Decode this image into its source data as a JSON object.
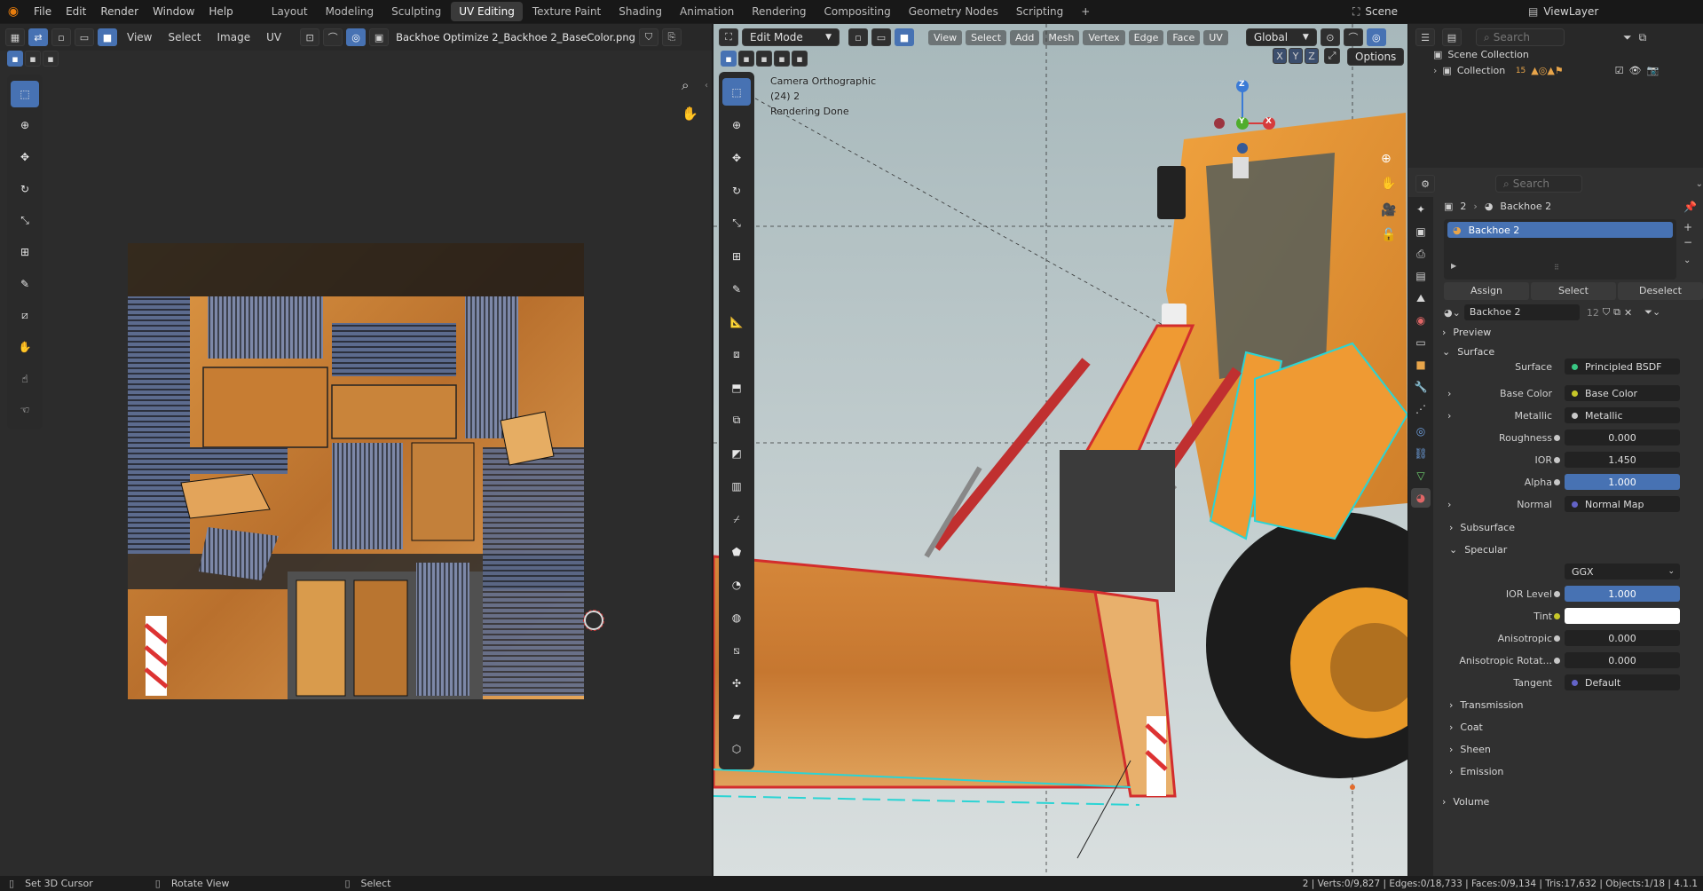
{
  "menu": {
    "items": [
      "File",
      "Edit",
      "Render",
      "Window",
      "Help"
    ]
  },
  "workspaces": {
    "tabs": [
      "Layout",
      "Modeling",
      "Sculpting",
      "UV Editing",
      "Texture Paint",
      "Shading",
      "Animation",
      "Rendering",
      "Compositing",
      "Geometry Nodes",
      "Scripting"
    ],
    "active": "UV Editing",
    "add_label": "+"
  },
  "scene": {
    "name": "Scene",
    "view_layer": "ViewLayer"
  },
  "uv_editor": {
    "menus": [
      "View",
      "Select",
      "Image",
      "UV"
    ],
    "image_name": "Backhoe Optimize 2_Backhoe 2_BaseColor.png"
  },
  "viewport": {
    "mode": "Edit Mode",
    "menus": [
      "View",
      "Select",
      "Add",
      "Mesh",
      "Vertex",
      "Edge",
      "Face",
      "UV"
    ],
    "transform_orientation": "Global",
    "axes": [
      "X",
      "Y",
      "Z"
    ],
    "options_label": "Options",
    "overlay_text": [
      "Camera Orthographic",
      "(24) 2",
      "Rendering Done"
    ],
    "gizmo_axes": {
      "z": "Z",
      "y": "Y",
      "x": "X"
    }
  },
  "outliner": {
    "search_placeholder": "Search",
    "scene_collection": "Scene Collection",
    "collection": "Collection",
    "collection_count": "15"
  },
  "properties": {
    "search_placeholder": "Search",
    "breadcrumb": {
      "object": "2",
      "material": "Backhoe 2"
    },
    "slot_name": "Backhoe 2",
    "assign_label": "Assign",
    "select_label": "Select",
    "deselect_label": "Deselect",
    "material_name": "Backhoe 2",
    "material_users": "12",
    "sections": {
      "preview": "Preview",
      "surface": "Surface",
      "specular": "Specular",
      "subsurface": "Subsurface",
      "transmission": "Transmission",
      "coat": "Coat",
      "sheen": "Sheen",
      "emission": "Emission",
      "volume": "Volume"
    },
    "rows": {
      "surface": {
        "label": "Surface",
        "value": "Principled BSDF"
      },
      "base_color": {
        "label": "Base Color",
        "value": "Base Color"
      },
      "metallic": {
        "label": "Metallic",
        "value": "Metallic"
      },
      "roughness": {
        "label": "Roughness",
        "value": "0.000"
      },
      "ior": {
        "label": "IOR",
        "value": "1.450"
      },
      "alpha": {
        "label": "Alpha",
        "value": "1.000"
      },
      "normal": {
        "label": "Normal",
        "value": "Normal Map"
      },
      "distribution": {
        "value": "GGX"
      },
      "ior_level": {
        "label": "IOR Level",
        "value": "1.000"
      },
      "tint": {
        "label": "Tint",
        "color": "#ffffff"
      },
      "anisotropic": {
        "label": "Anisotropic",
        "value": "0.000"
      },
      "anisotropic_rotation": {
        "label": "Anisotropic Rotat...",
        "value": "0.000"
      },
      "tangent": {
        "label": "Tangent",
        "value": "Default"
      }
    }
  },
  "status": {
    "left1": "Set 3D Cursor",
    "left2": "Rotate View",
    "left3": "Select",
    "stats": "2 | Verts:0/9,827 | Edges:0/18,733 | Faces:0/9,134 | Tris:17,632 | Objects:1/18 | 4.1.1"
  },
  "colors": {
    "accent": "#4772b3",
    "machine": "#d9822b",
    "background": "#a9babd"
  }
}
